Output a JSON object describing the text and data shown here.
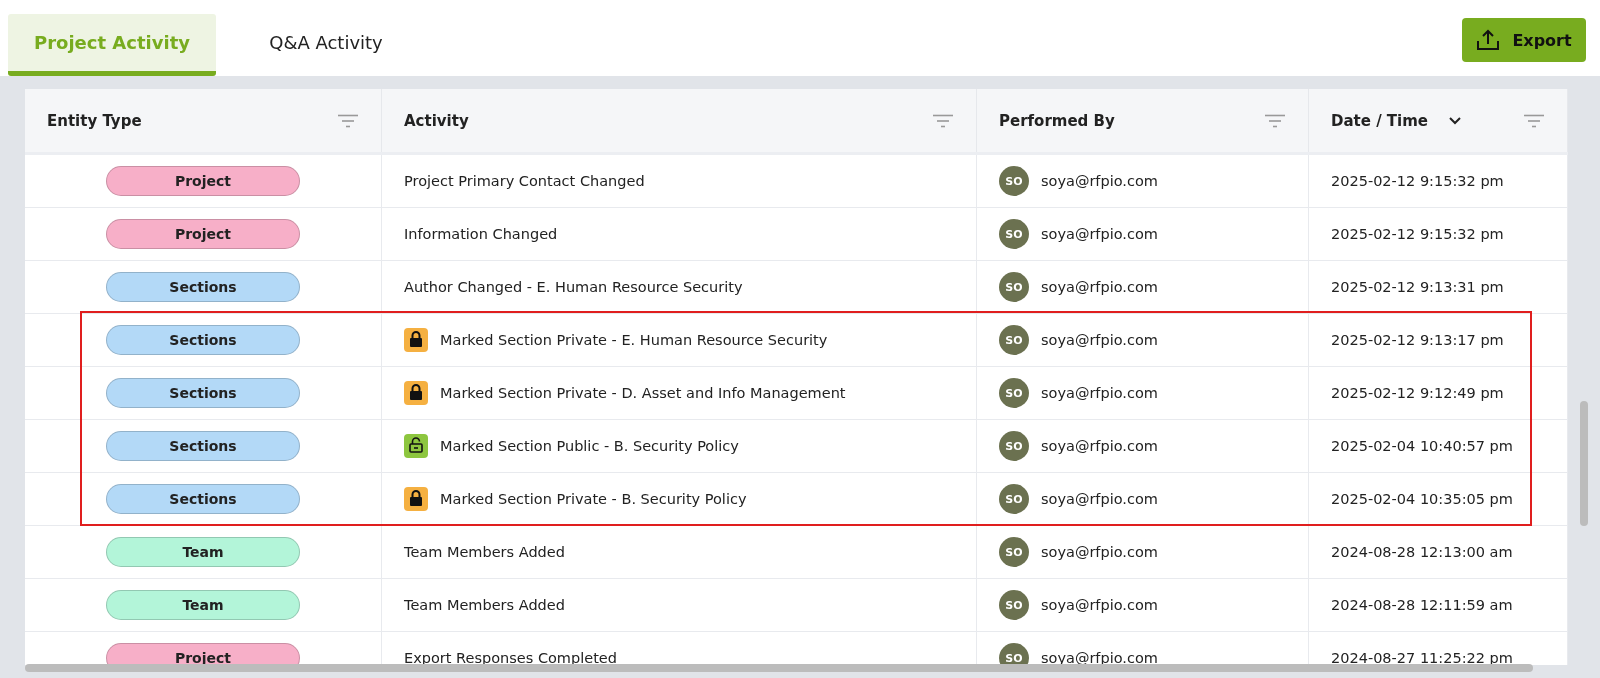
{
  "tabs": [
    {
      "label": "Project Activity",
      "selected": true
    },
    {
      "label": "Q&A Activity",
      "selected": false
    }
  ],
  "export_button": {
    "label": "Export"
  },
  "table": {
    "columns": [
      {
        "label": "Entity Type"
      },
      {
        "label": "Activity"
      },
      {
        "label": "Performed By"
      },
      {
        "label": "Date / Time",
        "sorted": true
      }
    ],
    "rows": [
      {
        "entity": "Project",
        "color": "#f7afc8",
        "activity": "Project Primary Contact Changed",
        "avatar": "SO",
        "user": "soya@rfpio.com",
        "date": "2025-02-12 9:15:32 pm",
        "highlighted": false
      },
      {
        "entity": "Project",
        "color": "#f7afc8",
        "activity": "Information Changed",
        "avatar": "SO",
        "user": "soya@rfpio.com",
        "date": "2025-02-12 9:15:32 pm",
        "highlighted": false
      },
      {
        "entity": "Sections",
        "color": "#b3d9f7",
        "activity": "Author Changed - E. Human Resource Security",
        "avatar": "SO",
        "user": "soya@rfpio.com",
        "date": "2025-02-12 9:13:31 pm",
        "highlighted": false
      },
      {
        "entity": "Sections",
        "color": "#b3d9f7",
        "kind": "private",
        "activity": "Marked Section Private - E. Human Resource Security",
        "avatar": "SO",
        "user": "soya@rfpio.com",
        "date": "2025-02-12 9:13:17 pm",
        "highlighted": true
      },
      {
        "entity": "Sections",
        "color": "#b3d9f7",
        "kind": "private",
        "activity": "Marked Section Private - D. Asset and Info Management",
        "avatar": "SO",
        "user": "soya@rfpio.com",
        "date": "2025-02-12 9:12:49 pm",
        "highlighted": true
      },
      {
        "entity": "Sections",
        "color": "#b3d9f7",
        "kind": "public",
        "activity": "Marked Section Public - B. Security Policy",
        "avatar": "SO",
        "user": "soya@rfpio.com",
        "date": "2025-02-04 10:40:57 pm",
        "highlighted": true
      },
      {
        "entity": "Sections",
        "color": "#b3d9f7",
        "kind": "private",
        "activity": "Marked Section Private - B. Security Policy",
        "avatar": "SO",
        "user": "soya@rfpio.com",
        "date": "2025-02-04 10:35:05 pm",
        "highlighted": true
      },
      {
        "entity": "Team",
        "color": "#b3f5d9",
        "activity": "Team Members Added",
        "avatar": "SO",
        "user": "soya@rfpio.com",
        "date": "2024-08-28 12:13:00 am",
        "highlighted": false
      },
      {
        "entity": "Team",
        "color": "#b3f5d9",
        "activity": "Team Members Added",
        "avatar": "SO",
        "user": "soya@rfpio.com",
        "date": "2024-08-28 12:11:59 am",
        "highlighted": false
      },
      {
        "entity": "Project",
        "color": "#f7afc8",
        "activity": "Export Responses Completed",
        "avatar": "SO",
        "user": "soya@rfpio.com",
        "date": "2024-08-27 11:25:22 pm",
        "highlighted": false
      }
    ]
  }
}
